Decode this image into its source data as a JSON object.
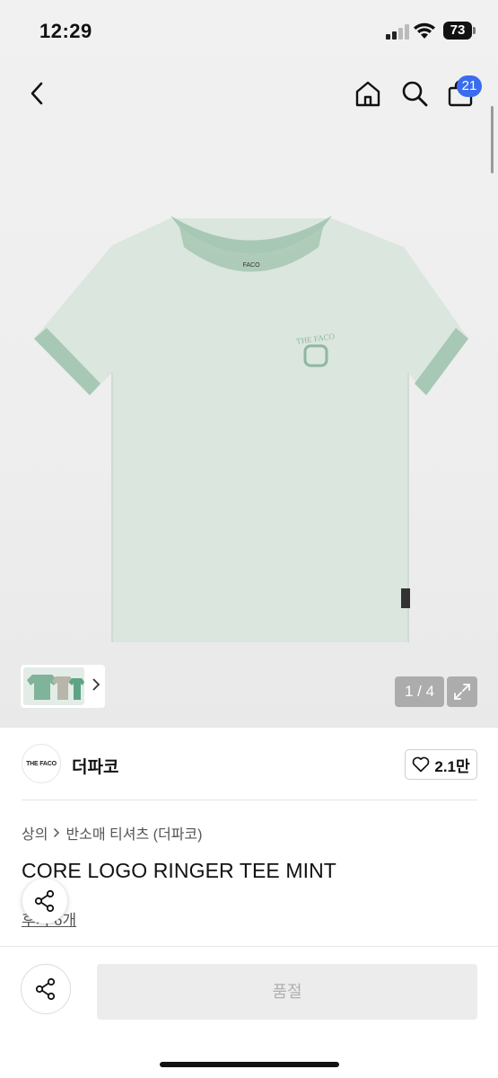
{
  "status_bar": {
    "time": "12:29",
    "battery": "73"
  },
  "nav": {
    "cart_badge": "21"
  },
  "gallery": {
    "counter": "1 / 4",
    "shirt_print_text": "THE FACO",
    "neck_label_text": "FACO"
  },
  "brand": {
    "logo_text": "THE FACO",
    "name": "더파코",
    "likes": "2.1만"
  },
  "breadcrumb": {
    "category": "상의",
    "subcategory": "반소매 티셔츠 (더파코)"
  },
  "product": {
    "title": "CORE LOGO RINGER TEE MINT",
    "review_text": "후기 6개"
  },
  "bottom": {
    "soldout_label": "품절"
  },
  "colors": {
    "shirt_body": "#dbe6de",
    "shirt_trim": "#a7c8b4",
    "badge": "#3b6cf0"
  }
}
